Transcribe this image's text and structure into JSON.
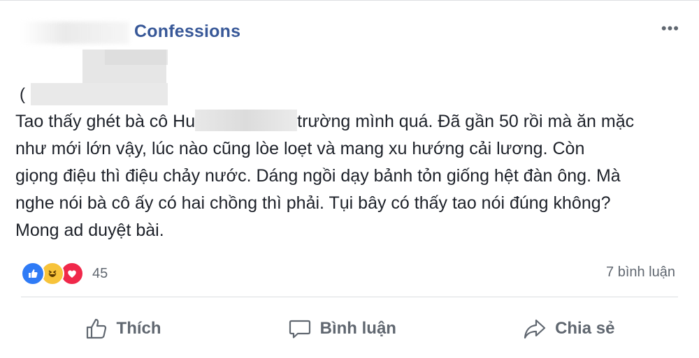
{
  "post": {
    "page_name": "Confessions",
    "more_glyph": "•••",
    "paren_open": "(",
    "body_part1": "Tao thấy ghét bà cô Hu",
    "body_part2": "trường mình quá. Đã gần 50 rồi mà ăn mặc\nnhư mới lớn vậy, lúc nào cũng lòe loẹt và mang xu hướng cải lương. Còn\ngiọng điệu thì điệu chảy nước. Dáng ngồi dạy bảnh tỏn giống hệt đàn ông. Mà\nnghe nói bà cô ấy có hai chồng thì phải. Tụi bây có thấy tao nói đúng không?\nMong ad duyệt bài."
  },
  "stats": {
    "reaction_icons": [
      "like-icon",
      "haha-icon",
      "love-icon"
    ],
    "reaction_count": "45",
    "comments_count": "7 bình luận"
  },
  "actions": {
    "like_label": "Thích",
    "comment_label": "Bình luận",
    "share_label": "Chia sẻ"
  },
  "colors": {
    "page_name": "#385898",
    "text": "#1d2129",
    "muted": "#606770",
    "like": "#2f7bf6",
    "haha": "#f7c33a",
    "love": "#f0284a"
  }
}
